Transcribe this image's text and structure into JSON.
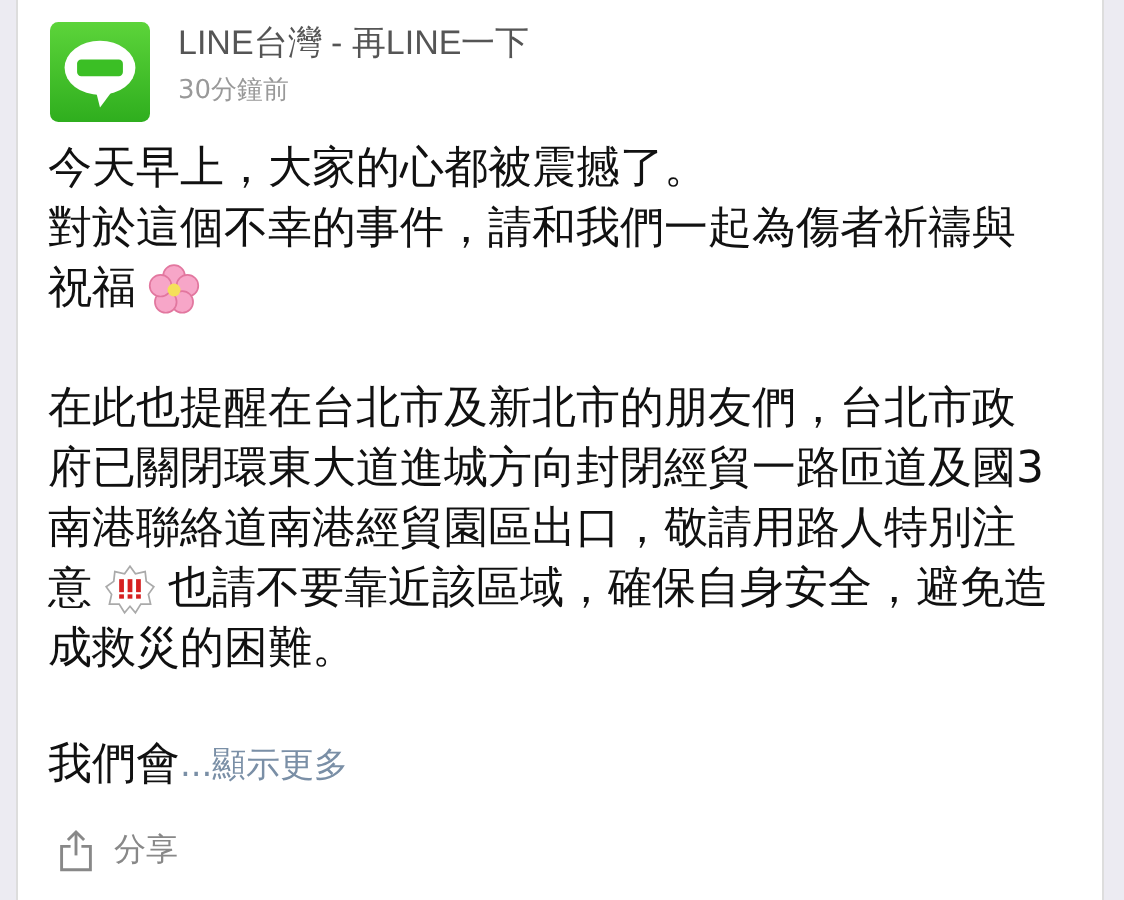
{
  "post": {
    "author": "LINE台灣 - 再LINE一下",
    "time": "30分鐘前",
    "paragraphs": [
      [
        [
          {
            "kind": "text",
            "text": "今天早上，大家的心都被震撼了。"
          }
        ],
        [
          {
            "kind": "text",
            "text": "對於這個不幸的事件，請和我們一起為傷者祈禱與"
          }
        ],
        [
          {
            "kind": "text",
            "text": "祝福"
          },
          {
            "kind": "flower"
          }
        ]
      ],
      [
        [
          {
            "kind": "text",
            "text": "在此也提醒在台北市及新北市的朋友們，台北市政"
          }
        ],
        [
          {
            "kind": "text",
            "text": "府已關閉環東大道進城方向封閉經貿一路匝道及國3"
          }
        ],
        [
          {
            "kind": "text",
            "text": "南港聯絡道南港經貿園區出口，敬請用路人特別注"
          }
        ],
        [
          {
            "kind": "text",
            "text": "意"
          },
          {
            "kind": "alert"
          },
          {
            "kind": "text",
            "text": "也請不要靠近該區域，確保自身安全，避免造"
          }
        ],
        [
          {
            "kind": "text",
            "text": "成救災的困難。"
          }
        ]
      ]
    ],
    "truncated_text": "我們會",
    "more_link": "...顯示更多",
    "share_label": "分享"
  }
}
